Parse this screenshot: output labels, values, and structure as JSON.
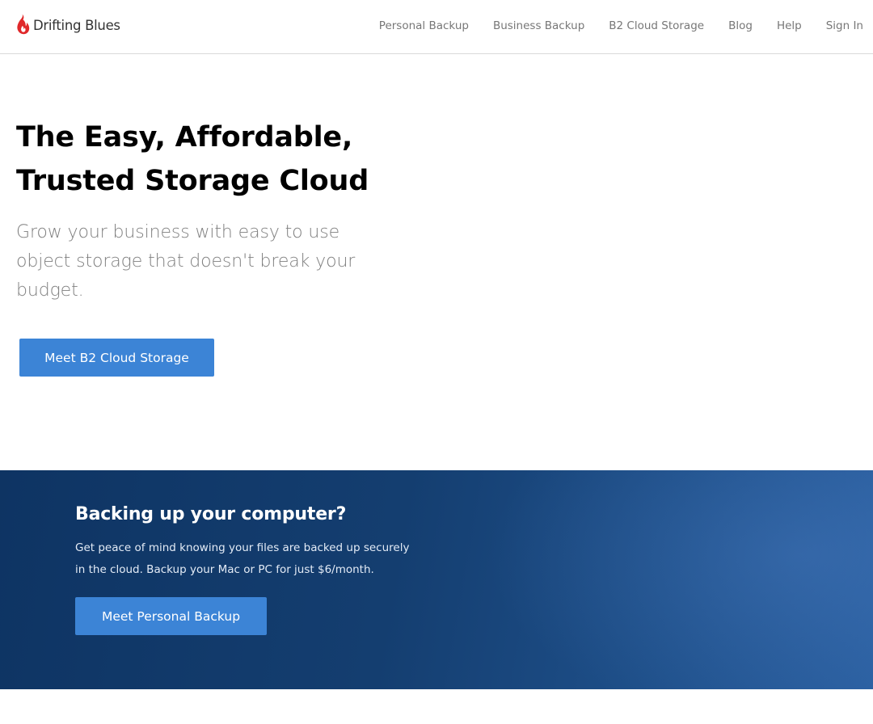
{
  "header": {
    "logo_text": "Drifting Blues",
    "nav": [
      {
        "label": "Personal Backup"
      },
      {
        "label": "Business Backup"
      },
      {
        "label": "B2 Cloud Storage"
      },
      {
        "label": "Blog"
      },
      {
        "label": "Help"
      },
      {
        "label": "Sign In"
      }
    ]
  },
  "hero": {
    "title_line1": "The Easy, Affordable,",
    "title_line2": "Trusted Storage Cloud",
    "subtitle": "Grow your business with easy to use object storage that doesn't break your budget.",
    "cta_label": "Meet B2 Cloud Storage"
  },
  "banner": {
    "title": "Backing up your computer?",
    "text_line1": "Get peace of mind knowing your files are backed up securely",
    "text_line2": "in the cloud. Backup your Mac or PC for just $6/month.",
    "cta_label": "Meet Personal Backup"
  },
  "icons": {
    "logo": "flame-logo-icon"
  },
  "colors": {
    "brand_red": "#e0282a",
    "button_blue": "#3c84d6",
    "banner_navy": "#143e70",
    "nav_text": "#777777"
  }
}
